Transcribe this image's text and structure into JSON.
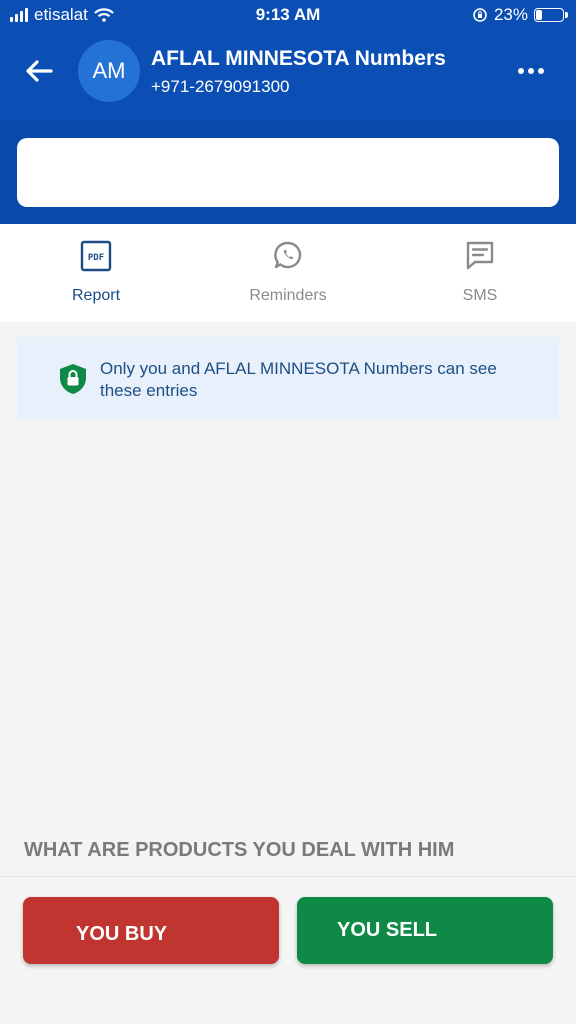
{
  "status_bar": {
    "carrier": "etisalat",
    "time": "9:13 AM",
    "battery": "23%"
  },
  "header": {
    "avatar_initials": "AM",
    "contact_name": "AFLAL MINNESOTA Numbers",
    "contact_phone": "+971-2679091300"
  },
  "actions": [
    {
      "label": "Report",
      "icon": "pdf-icon"
    },
    {
      "label": "Reminders",
      "icon": "whatsapp-icon"
    },
    {
      "label": "SMS",
      "icon": "message-icon"
    }
  ],
  "pdf_icon_text": "PDF",
  "notice": {
    "text": "Only you and AFLAL MINNESOTA Numbers can see these entries",
    "icon": "shield-lock-icon"
  },
  "products_prompt": "WHAT ARE PRODUCTS YOU DEAL WITH HIM",
  "buttons": {
    "buy": "YOU BUY",
    "sell": "YOU SELL"
  },
  "colors": {
    "header": "#0b4fb4",
    "accent_text": "#1b4e86",
    "buy": "#c03530",
    "sell": "#0e8a46",
    "notice_bg": "#e8f0fb"
  }
}
